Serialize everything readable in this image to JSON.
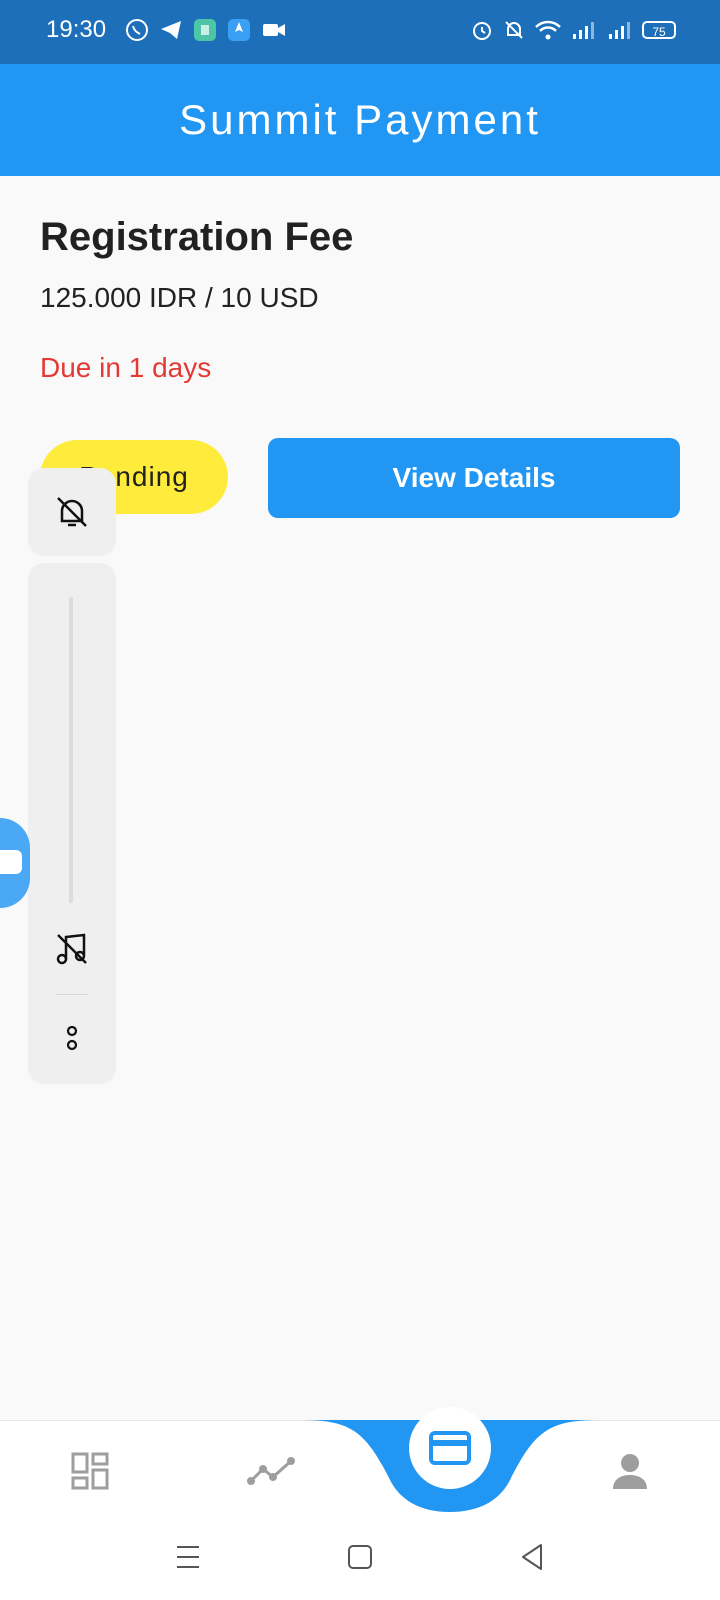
{
  "status_bar": {
    "time": "19:30",
    "left_icons": [
      "whatsapp-icon",
      "telegram-icon",
      "app-icon",
      "rocket-app-icon",
      "video-icon"
    ],
    "right_icons": [
      "alarm-icon",
      "bell-off-icon",
      "wifi-icon",
      "signal-icon",
      "signal-icon"
    ],
    "battery": "75"
  },
  "app_bar": {
    "title": "Summit Payment"
  },
  "payment": {
    "title": "Registration Fee",
    "amount": "125.000 IDR / 10 USD",
    "due": "Due in 1 days",
    "status": "Pending",
    "details_button": "View Details"
  },
  "volume_overlay": {
    "icons": [
      "bell-off-icon",
      "music-off-icon",
      "more-icon"
    ]
  },
  "bottom_nav": {
    "items": [
      "dashboard-icon",
      "chart-icon",
      "payment-card-icon",
      "profile-icon"
    ],
    "active": "payment-card-icon"
  },
  "system_nav": {
    "icons": [
      "menu-icon",
      "home-icon",
      "back-icon"
    ]
  },
  "colors": {
    "primary": "#2196f3",
    "status_bar": "#1c6fb8",
    "pending": "#ffeb3b",
    "due": "#e53935"
  }
}
